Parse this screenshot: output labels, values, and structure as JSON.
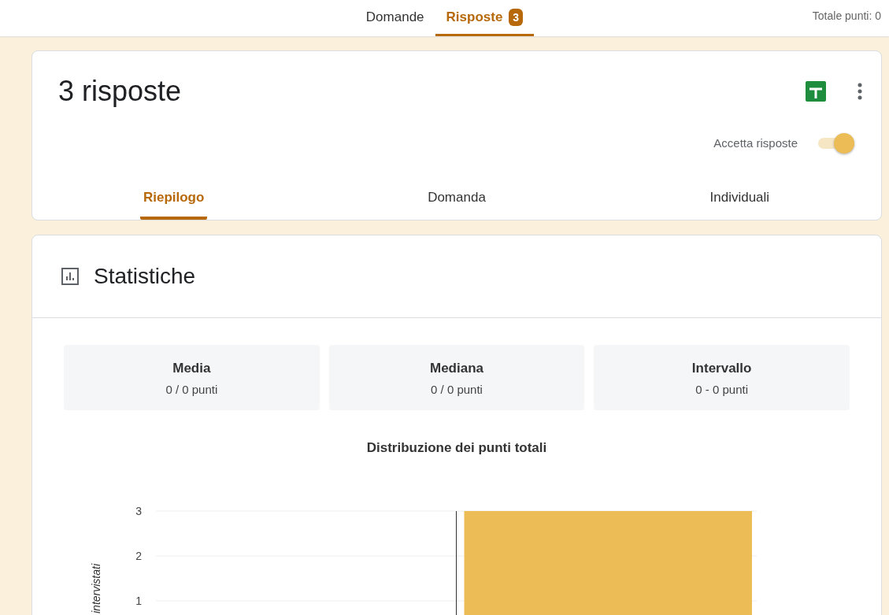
{
  "top_tabs": [
    {
      "label": "Domande",
      "selected": false
    },
    {
      "label": "Risposte",
      "selected": true,
      "badge": "3"
    }
  ],
  "total_points": "Totale punti: 0",
  "responses": {
    "title": "3 risposte",
    "accepting_label": "Accetta risposte",
    "accepting": true,
    "tabs": [
      {
        "label": "Riepilogo",
        "selected": true
      },
      {
        "label": "Domanda",
        "selected": false
      },
      {
        "label": "Individuali",
        "selected": false
      }
    ]
  },
  "stats": {
    "title": "Statistiche",
    "cards": [
      {
        "label": "Media",
        "value": "0 / 0 punti"
      },
      {
        "label": "Mediana",
        "value": "0 / 0 punti"
      },
      {
        "label": "Intervallo",
        "value": "0 - 0 punti"
      }
    ],
    "chart_data": {
      "type": "bar",
      "title": "Distribuzione dei punti totali",
      "ylabel": "intervistati",
      "values": [
        null,
        3
      ],
      "ylim": [
        0,
        3
      ],
      "yticks": [
        1,
        2,
        3
      ]
    }
  }
}
